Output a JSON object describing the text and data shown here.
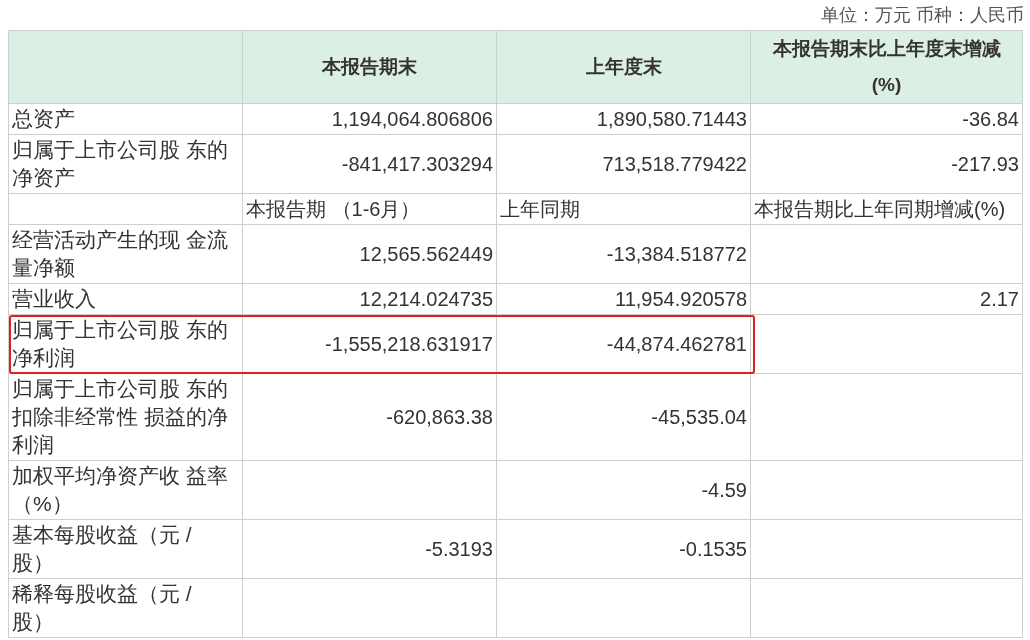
{
  "unit_note": "单位：万元 币种：人民币",
  "table": {
    "columns": [
      {},
      {
        "label": "本报告期末"
      },
      {
        "label": "上年度末"
      },
      {
        "label": "本报告期末比上年度末增减\n(%)"
      }
    ],
    "rows": [
      {
        "kind": "data",
        "highlighted": false,
        "cells": [
          "总资产",
          "1,194,064.806806",
          "1,890,580.71443",
          "-36.84"
        ]
      },
      {
        "kind": "data",
        "highlighted": false,
        "cells": [
          "归属于上市公司股 东的净资产",
          "-841,417.303294",
          "713,518.779422",
          "-217.93"
        ]
      },
      {
        "kind": "subheader",
        "highlighted": false,
        "cells": [
          null,
          "本报告期 （1-6月）",
          "上年同期",
          "本报告期比上年同期增减(%)"
        ]
      },
      {
        "kind": "data",
        "highlighted": false,
        "cells": [
          "经营活动产生的现 金流量净额",
          "12,565.562449",
          "-13,384.518772",
          null
        ]
      },
      {
        "kind": "data",
        "highlighted": false,
        "cells": [
          "营业收入",
          "12,214.024735",
          "11,954.920578",
          "2.17"
        ]
      },
      {
        "kind": "data",
        "highlighted": true,
        "cells": [
          "归属于上市公司股 东的净利润",
          "-1,555,218.631917",
          "-44,874.462781",
          null
        ]
      },
      {
        "kind": "data",
        "highlighted": false,
        "cells": [
          "归属于上市公司股 东的扣除非经常性 损益的净利润",
          "-620,863.38",
          "-45,535.04",
          null
        ]
      },
      {
        "kind": "data",
        "highlighted": false,
        "cells": [
          "加权平均净资产收 益率（%）",
          null,
          "-4.59",
          null
        ]
      },
      {
        "kind": "data",
        "highlighted": false,
        "cells": [
          "基本每股收益（元 / 股）",
          "-5.3193",
          "-0.1535",
          null
        ]
      },
      {
        "kind": "data",
        "highlighted": false,
        "cells": [
          "稀释每股收益（元 / 股）",
          null,
          null,
          null
        ]
      }
    ]
  }
}
